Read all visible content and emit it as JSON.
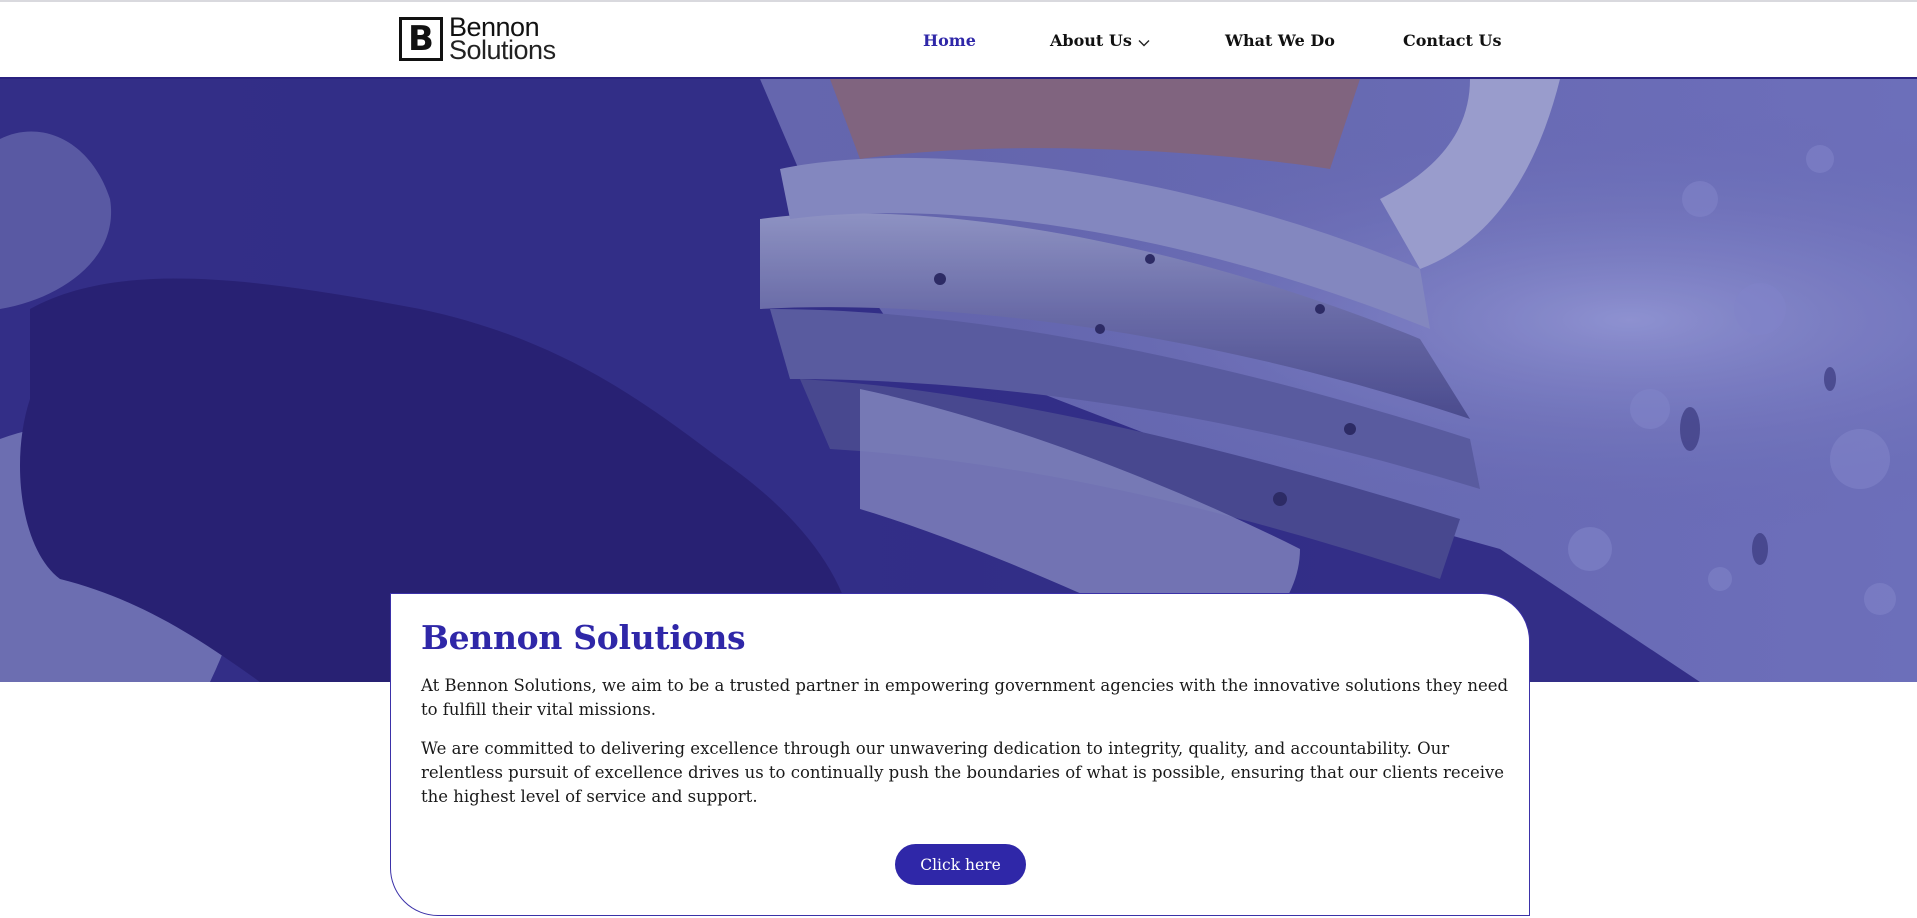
{
  "header": {
    "logo": {
      "mark": "B",
      "line1": "Bennon",
      "line2": "Solutions"
    },
    "nav": [
      {
        "label": "Home",
        "active": true
      },
      {
        "label": "About Us",
        "has_dropdown": true
      },
      {
        "label": "What We Do"
      },
      {
        "label": "Contact Us"
      }
    ]
  },
  "hero": {
    "image": "astronaut-helmet-photo",
    "tint_color": "#3a2f9e"
  },
  "card": {
    "title": "Bennon Solutions",
    "paragraphs": [
      "At Bennon Solutions, we aim to be a trusted partner in empowering government agencies with the innovative solutions they need to fulfill their vital missions.",
      "We are committed to delivering excellence through our unwavering dedication to integrity, quality, and accountability. Our relentless pursuit of excellence drives us to continually push the boundaries of what is possible, ensuring that our clients receive the highest level of service and support."
    ],
    "button_label": "Click here"
  },
  "colors": {
    "accent": "#2f27a8",
    "text": "#1a1a1a",
    "header_bg": "#ffffff"
  },
  "icons": {
    "dropdown": "chevron-down-icon"
  }
}
